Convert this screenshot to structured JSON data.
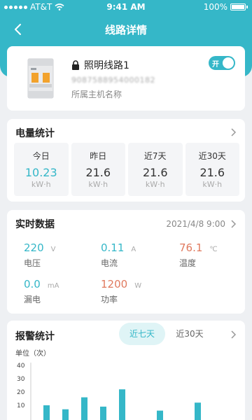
{
  "status_bar": {
    "carrier": "AT&T",
    "time": "9:41 AM",
    "battery": "100%"
  },
  "nav": {
    "title": "线路详情"
  },
  "device": {
    "name": "照明线路1",
    "serial": "9087588954000182",
    "host": "所属主机名称",
    "toggle_label": "开",
    "toggle_on": true
  },
  "energy": {
    "title": "电量统计",
    "items": [
      {
        "label": "今日",
        "value": "10.23",
        "unit": "kW·h"
      },
      {
        "label": "昨日",
        "value": "21.6",
        "unit": "kW·h"
      },
      {
        "label": "近7天",
        "value": "21.6",
        "unit": "kW·h"
      },
      {
        "label": "近30天",
        "value": "21.6",
        "unit": "kW·h"
      }
    ]
  },
  "realtime": {
    "title": "实时数据",
    "timestamp": "2021/4/8  9:00",
    "metrics": [
      {
        "value": "220",
        "unit": "V",
        "label": "电压"
      },
      {
        "value": "0.11",
        "unit": "A",
        "label": "电流"
      },
      {
        "value": "76.1",
        "unit": "℃",
        "label": "温度"
      },
      {
        "value": "0.0",
        "unit": "mA",
        "label": "漏电"
      },
      {
        "value": "1200",
        "unit": "W",
        "label": "功率"
      }
    ]
  },
  "alarm": {
    "title": "报警统计",
    "tabs": [
      "近七天",
      "近30天"
    ],
    "active_tab": 0,
    "unit_label": "单位（次）"
  },
  "colors": {
    "accent": "#35b7c8",
    "warning": "#e07a5f"
  },
  "chart_data": {
    "type": "bar",
    "ylim": [
      0,
      40
    ],
    "y_ticks": [
      40,
      30,
      20,
      10
    ],
    "values": [
      10,
      7,
      16,
      9,
      22,
      0,
      6,
      0,
      12
    ],
    "bar_color": "#35b7c8"
  }
}
